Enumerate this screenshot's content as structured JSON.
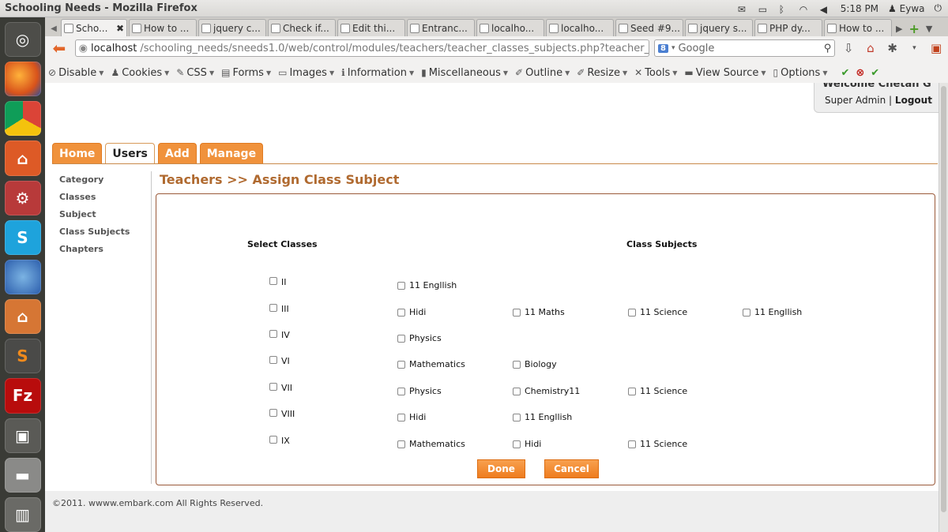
{
  "window": {
    "title": "Schooling Needs - Mozilla Firefox"
  },
  "panel": {
    "time": "5:18 PM",
    "user": "Eywa"
  },
  "launcher": {
    "skype_glyph": "S",
    "sublime_glyph": "S",
    "filezilla_glyph": "Fz"
  },
  "browser_tabs": [
    {
      "label": "Scho...",
      "active": true
    },
    {
      "label": "How to ..."
    },
    {
      "label": "jquery c..."
    },
    {
      "label": "Check if..."
    },
    {
      "label": "Edit thi..."
    },
    {
      "label": "Entranc..."
    },
    {
      "label": "localho..."
    },
    {
      "label": "localho..."
    },
    {
      "label": "Seed #9..."
    },
    {
      "label": "jquery s..."
    },
    {
      "label": "PHP dy..."
    },
    {
      "label": "How to ..."
    }
  ],
  "url": {
    "host": "localhost",
    "path": "/schooling_needs/sneeds1.0/web/control/modules/teachers/teacher_classes_subjects.php?teacher_ic"
  },
  "search": {
    "engine_badge": "8",
    "placeholder": "Google"
  },
  "webdev_toolbar": [
    {
      "label": "Disable",
      "glyph": "⊘"
    },
    {
      "label": "Cookies",
      "glyph": "♟"
    },
    {
      "label": "CSS",
      "glyph": "✎"
    },
    {
      "label": "Forms",
      "glyph": "▤"
    },
    {
      "label": "Images",
      "glyph": "▭"
    },
    {
      "label": "Information",
      "glyph": "ℹ"
    },
    {
      "label": "Miscellaneous",
      "glyph": "▮"
    },
    {
      "label": "Outline",
      "glyph": "✐"
    },
    {
      "label": "Resize",
      "glyph": "✐"
    },
    {
      "label": "Tools",
      "glyph": "✕"
    },
    {
      "label": "View Source",
      "glyph": "▬"
    },
    {
      "label": "Options",
      "glyph": "▯"
    }
  ],
  "header": {
    "welcome": "Welcome Chetan G",
    "role": "Super Admin",
    "separator": "|",
    "logout": "Logout"
  },
  "main_tabs": [
    {
      "label": "Home"
    },
    {
      "label": "Users",
      "active": true
    },
    {
      "label": "Add"
    },
    {
      "label": "Manage"
    }
  ],
  "sidebar": {
    "items": [
      "Category",
      "Classes",
      "Subject",
      "Class Subjects",
      "Chapters"
    ]
  },
  "page_title": "Teachers >> Assign Class Subject",
  "form": {
    "select_classes_heading": "Select Classes",
    "class_subjects_heading": "Class Subjects",
    "classes": [
      "II",
      "III",
      "IV",
      "VI",
      "VII",
      "VIII",
      "IX"
    ],
    "subject_rows": [
      [
        "11 Engllish"
      ],
      [
        "Hidi",
        "11 Maths",
        "11 Science",
        "11 Engllish"
      ],
      [
        "Physics"
      ],
      [
        "Mathematics",
        "Biology"
      ],
      [
        "Physics",
        "Chemistry11",
        "11 Science"
      ],
      [
        "Hidi",
        "11 Engllish"
      ],
      [
        "Mathematics",
        "Hidi",
        "11 Science"
      ]
    ],
    "done_label": "Done",
    "cancel_label": "Cancel"
  },
  "footer": {
    "copyright": "©2011. wwww.embark.com All Rights Reserved."
  }
}
